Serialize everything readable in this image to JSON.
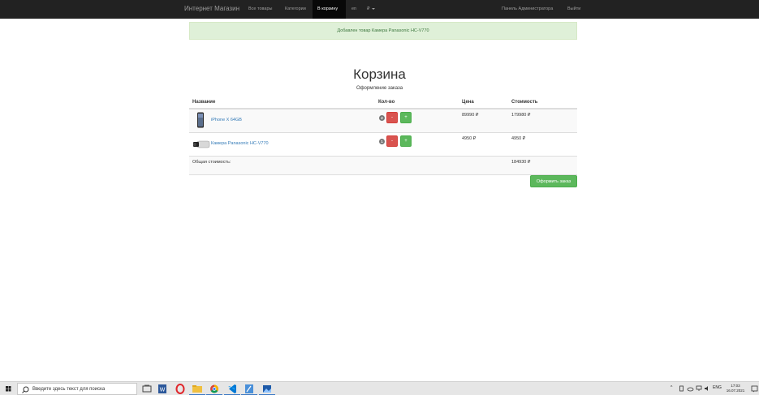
{
  "navbar": {
    "brand": "Интернет Магазин",
    "links": [
      "Все товары",
      "Категории",
      "В корзину",
      "en",
      "₽"
    ],
    "admin": "Панель Администратора",
    "logout": "Выйти"
  },
  "alert": {
    "text": "Добавлен товар Камера Panasonic HC-V770"
  },
  "cart": {
    "title": "Корзина",
    "subtitle": "Оформление заказа",
    "headers": {
      "name": "Название",
      "qty": "Кол-во",
      "price": "Цена",
      "cost": "Стоимость"
    },
    "items": [
      {
        "name": "iPhone X 64GB",
        "qty": "2",
        "price": "89990 ₽",
        "cost": "179980 ₽",
        "minus": "-",
        "plus": "+"
      },
      {
        "name": "Камера Panasonic HC-V770",
        "qty": "1",
        "price": "4950 ₽",
        "cost": "4950 ₽",
        "minus": "-",
        "plus": "+"
      }
    ],
    "total_label": "Общая стоимость:",
    "total_value": "184930 ₽",
    "order_button": "Оформить заказ"
  },
  "taskbar": {
    "search_placeholder": "Введите здесь текст для поиска",
    "lang": "ENG",
    "time": "17:03",
    "date": "16.07.2021"
  },
  "colors": {
    "navbar": "#222222",
    "alert_bg": "#dff0d8",
    "alert_text": "#3c763d",
    "danger": "#d9534f",
    "success": "#5cb85c",
    "link": "#337ab7"
  }
}
